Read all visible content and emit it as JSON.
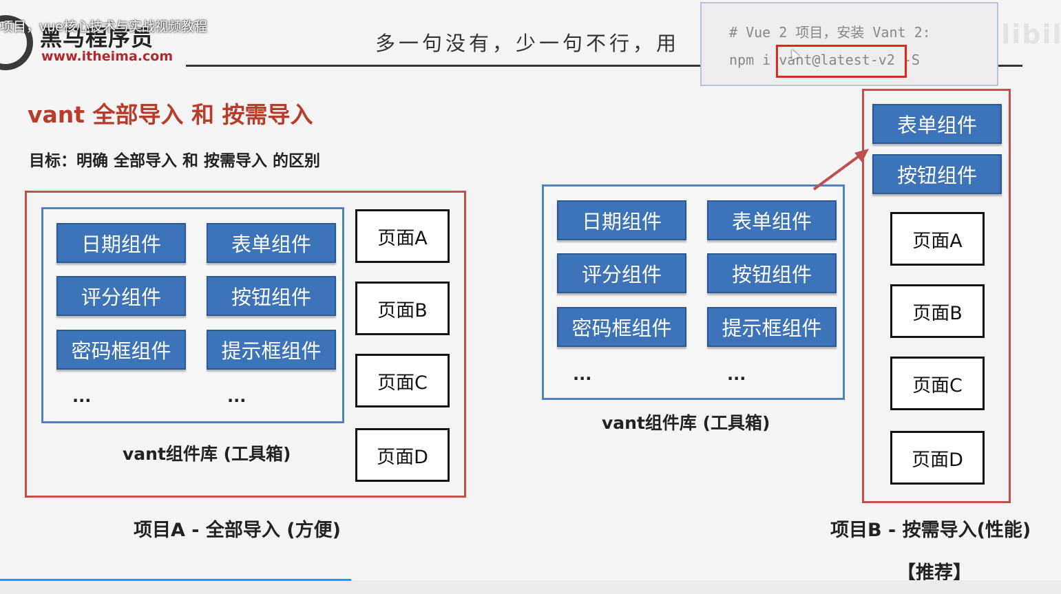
{
  "header": {
    "video_title": "项目，vue核心技术与实战视频教程",
    "logo_name": "黑马程序员",
    "logo_url": "www.itheima.com",
    "slogan": "多一句没有，少一句不行，用",
    "watermark": "bilibili"
  },
  "code_popup": {
    "line1": "# Vue 2 项目，安装 Vant 2:",
    "line2": "npm i vant@latest-v2 -S",
    "highlighted": "vant@latest-v2"
  },
  "main_title": "vant 全部导入 和 按需导入",
  "goal": "目标：明确 全部导入 和 按需导入 的区别",
  "project_a": {
    "components": [
      "日期组件",
      "表单组件",
      "评分组件",
      "按钮组件",
      "密码框组件",
      "提示框组件"
    ],
    "more": [
      "...",
      "..."
    ],
    "library_label": "vant组件库 (工具箱)",
    "pages": [
      "页面A",
      "页面B",
      "页面C",
      "页面D"
    ],
    "caption": "项目A - 全部导入 (方便)"
  },
  "project_b": {
    "library_components": [
      "日期组件",
      "表单组件",
      "评分组件",
      "按钮组件",
      "密码框组件",
      "提示框组件"
    ],
    "more": [
      "...",
      "..."
    ],
    "library_label": "vant组件库 (工具箱)",
    "imported_components": [
      "表单组件",
      "按钮组件"
    ],
    "pages": [
      "页面A",
      "页面B",
      "页面C",
      "页面D"
    ],
    "caption": "项目B - 按需导入(性能)",
    "recommend": "【推荐】"
  },
  "colors": {
    "accent_red": "#c0504d",
    "title_red": "#b83c2a",
    "component_blue": "#3d73b9",
    "frame_blue": "#4f81bd",
    "progress": "#0aa3e8"
  }
}
